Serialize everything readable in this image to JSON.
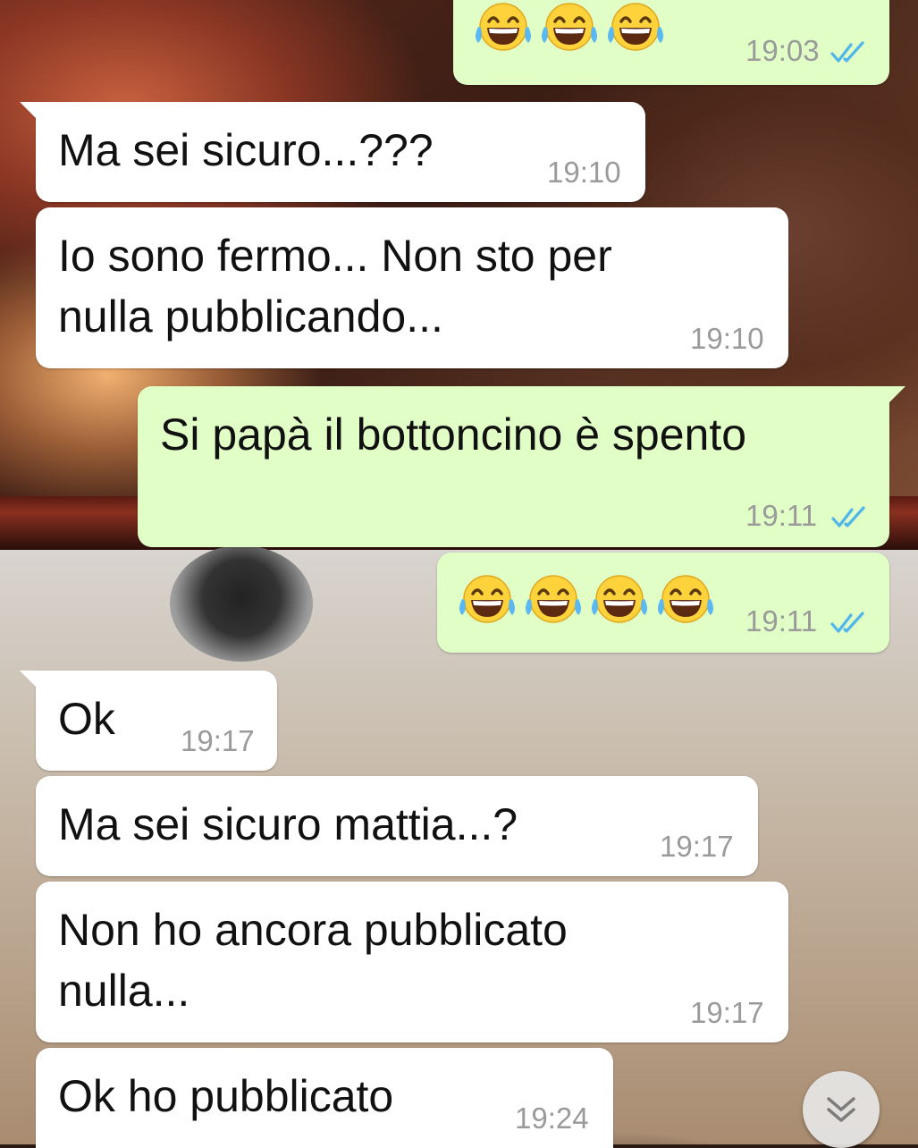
{
  "messages": [
    {
      "direction": "out",
      "content": "😂😂😂",
      "time": "19:03",
      "status": "read"
    },
    {
      "direction": "in",
      "content": "Ma sei sicuro...???",
      "time": "19:10"
    },
    {
      "direction": "in",
      "content_lines": [
        "Io sono fermo... Non sto per",
        "nulla pubblicando..."
      ],
      "time": "19:10"
    },
    {
      "direction": "out",
      "content": "Si papà il bottoncino è spento",
      "time": "19:11",
      "status": "read"
    },
    {
      "direction": "out",
      "content": "😂😂😂😂",
      "time": "19:11",
      "status": "read"
    },
    {
      "direction": "in",
      "content": "Ok",
      "time": "19:17"
    },
    {
      "direction": "in",
      "content": "Ma sei sicuro mattia...?",
      "time": "19:17"
    },
    {
      "direction": "in",
      "content_lines": [
        "Non ho ancora pubblicato",
        "nulla..."
      ],
      "time": "19:17"
    },
    {
      "direction": "in",
      "content": "Ok ho pubblicato",
      "time": "19:24"
    }
  ],
  "scroll_down_button": {
    "icon": "double-chevron-down-icon"
  },
  "colors": {
    "incoming_bubble": "#ffffff",
    "outgoing_bubble": "#e1fec6",
    "timestamp": "#9a9a9a",
    "read_ticks": "#4fb6ec"
  }
}
